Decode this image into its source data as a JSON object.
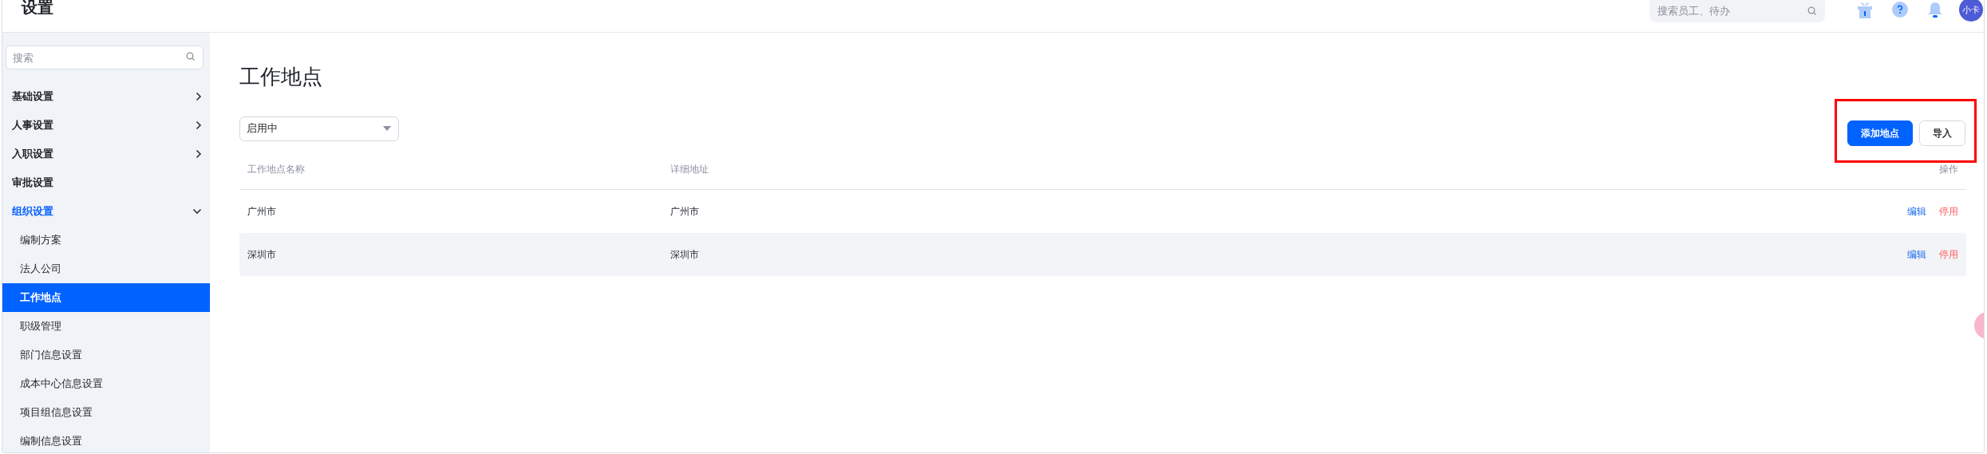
{
  "header": {
    "title": "设置",
    "search": {
      "placeholder": "搜索员工、待办"
    },
    "avatar": "小卡"
  },
  "sidebar": {
    "search": {
      "placeholder": "搜索"
    },
    "items": [
      {
        "label": "基础设置",
        "kind": "group",
        "expanded": false,
        "selected": false
      },
      {
        "label": "人事设置",
        "kind": "group",
        "expanded": false,
        "selected": false
      },
      {
        "label": "入职设置",
        "kind": "group",
        "expanded": false,
        "selected": false
      },
      {
        "label": "审批设置",
        "kind": "leaf",
        "selected": false
      },
      {
        "label": "组织设置",
        "kind": "group",
        "expanded": true,
        "selected": true,
        "children": [
          {
            "label": "编制方案",
            "selected": false
          },
          {
            "label": "法人公司",
            "selected": false
          },
          {
            "label": "工作地点",
            "selected": true
          },
          {
            "label": "职级管理",
            "selected": false
          },
          {
            "label": "部门信息设置",
            "selected": false
          },
          {
            "label": "成本中心信息设置",
            "selected": false
          },
          {
            "label": "项目组信息设置",
            "selected": false
          },
          {
            "label": "编制信息设置",
            "selected": false
          }
        ]
      }
    ]
  },
  "page": {
    "title": "工作地点",
    "filter": {
      "value": "启用中"
    },
    "buttons_highlighted": true,
    "buttons": [
      {
        "label": "添加地点",
        "kind": "primary"
      },
      {
        "label": "导入",
        "kind": "default"
      }
    ],
    "table": {
      "columns": [
        "工作地点名称",
        "详细地址",
        "操作"
      ],
      "rows": [
        {
          "cells": [
            "广州市",
            "广州市"
          ],
          "actions": [
            {
              "label": "编辑",
              "kind": "edit"
            },
            {
              "label": "停用",
              "kind": "disable"
            }
          ]
        },
        {
          "cells": [
            "深圳市",
            "深圳市"
          ],
          "actions": [
            {
              "label": "编辑",
              "kind": "edit"
            },
            {
              "label": "停用",
              "kind": "disable"
            }
          ]
        }
      ]
    }
  }
}
